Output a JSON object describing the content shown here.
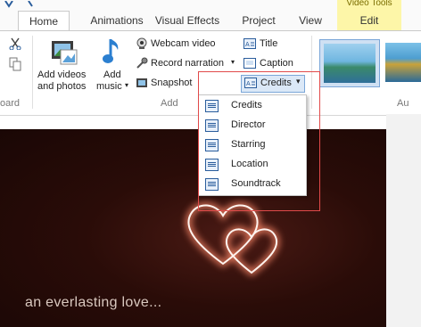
{
  "tabs": {
    "home": "Home",
    "animations": "Animations",
    "visual_effects": "Visual Effects",
    "project": "Project",
    "view": "View",
    "context_group": "Video Tools",
    "edit": "Edit"
  },
  "ribbon": {
    "add_videos_line1": "Add videos",
    "add_videos_line2": "and photos",
    "add_music_line1": "Add",
    "add_music_line2": "music",
    "webcam_video": "Webcam video",
    "record_narration": "Record narration",
    "snapshot": "Snapshot",
    "title": "Title",
    "caption": "Caption",
    "credits": "Credits",
    "group_add": "Add",
    "group_board_partial": "oard",
    "group_au_partial": "Au"
  },
  "credits_menu": {
    "items": [
      {
        "label": "Credits"
      },
      {
        "label": "Director"
      },
      {
        "label": "Starring"
      },
      {
        "label": "Location"
      },
      {
        "label": "Soundtrack"
      }
    ]
  },
  "preview": {
    "caption": "an everlasting love..."
  },
  "colors": {
    "highlight_border": "#e14a4a",
    "context_tab": "#fdf6a8",
    "icon_blue": "#2a5d9c"
  }
}
